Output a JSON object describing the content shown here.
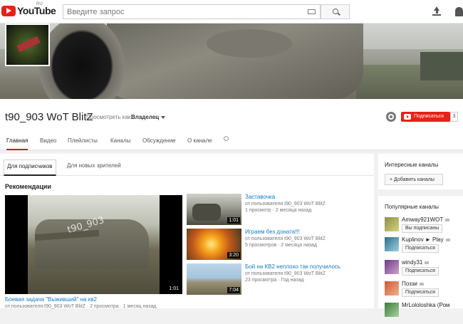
{
  "header": {
    "logo_text": "YouTube",
    "logo_region": "RU",
    "search_placeholder": "Введите запрос"
  },
  "channel": {
    "title": "t90_903 WoT BlitZ",
    "view_as_label": "Просмотреть как:",
    "view_as_value": "Владелец",
    "subscribe_label": "Подписаться",
    "subscriber_count": "3"
  },
  "tabs": [
    {
      "label": "Главная",
      "active": true
    },
    {
      "label": "Видео",
      "active": false
    },
    {
      "label": "Плейлисты",
      "active": false
    },
    {
      "label": "Каналы",
      "active": false
    },
    {
      "label": "Обсуждение",
      "active": false
    },
    {
      "label": "О канале",
      "active": false
    }
  ],
  "subtabs": [
    {
      "label": "Для подписчиков",
      "active": true
    },
    {
      "label": "Для новых зрителей",
      "active": false
    }
  ],
  "recommendations": {
    "section_title": "Рекомендации",
    "featured": {
      "title": "Боевая задача \"Выживший\" на кв2",
      "duration": "1:01",
      "watermark": "t90_903",
      "meta": "от пользователя t90_903 WoT BlitZ · 2 просмотра · 1 месяц назад"
    },
    "videos": [
      {
        "title": "Заставочка",
        "by": "от пользователя t90_903 WoT BlitZ",
        "views": "1 просмотр",
        "age": "2 месяца назад",
        "duration": "1:01"
      },
      {
        "title": "Играем без доната!!!",
        "by": "от пользователя t90_903 WoT BlitZ",
        "views": "5 просмотров",
        "age": "2 месяца назад",
        "duration": "3:20"
      },
      {
        "title": "Бой на КВ2 неплохо так получилось",
        "by": "от пользователя t90_903 WoT BlitZ",
        "views": "23 просмотра",
        "age": "Год назад",
        "duration": "7:04"
      }
    ]
  },
  "sidebar": {
    "interesting_title": "Интересные каналы",
    "add_channels_label": "+ Добавить каналы",
    "popular_title": "Популярные каналы",
    "channels": [
      {
        "name": "Amway921WOT",
        "button": "Вы подписаны"
      },
      {
        "name": "Kuplinov ► Play",
        "button": "Подписаться"
      },
      {
        "name": "windy31",
        "button": "Подписаться"
      },
      {
        "name": "Поззи",
        "button": "Подписаться"
      },
      {
        "name": "MrLololoshka (Ром",
        "button": ""
      }
    ]
  }
}
